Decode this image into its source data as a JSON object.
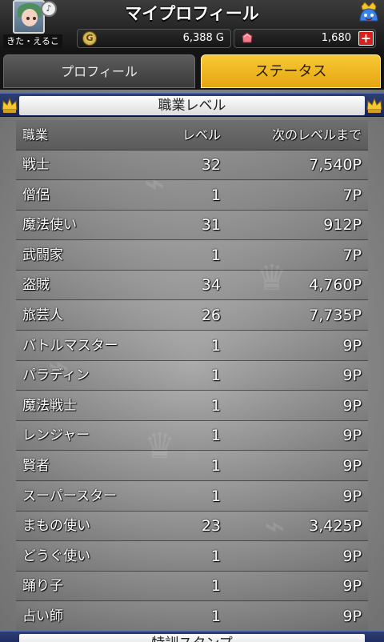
{
  "header": {
    "title": "マイプロフィール",
    "player_name": "きた・えるこ",
    "gold": "6,388 G",
    "gems": "1,680",
    "coin_symbol": "G",
    "plus_symbol": "+",
    "badge_symbol": "♪"
  },
  "tabs": [
    {
      "label": "プロフィール",
      "selected": false
    },
    {
      "label": "ステータス",
      "selected": true
    }
  ],
  "section": {
    "title": "職業レベル",
    "next_section_title": "特訓スタンプ"
  },
  "table": {
    "headers": {
      "job": "職業",
      "level": "レベル",
      "next": "次のレベルまで"
    },
    "rows": [
      {
        "job": "戦士",
        "level": "32",
        "next": "7,540P"
      },
      {
        "job": "僧侶",
        "level": "1",
        "next": "7P"
      },
      {
        "job": "魔法使い",
        "level": "31",
        "next": "912P"
      },
      {
        "job": "武闘家",
        "level": "1",
        "next": "7P"
      },
      {
        "job": "盗賊",
        "level": "34",
        "next": "4,760P"
      },
      {
        "job": "旅芸人",
        "level": "26",
        "next": "7,735P"
      },
      {
        "job": "バトルマスター",
        "level": "1",
        "next": "9P"
      },
      {
        "job": "パラディン",
        "level": "1",
        "next": "9P"
      },
      {
        "job": "魔法戦士",
        "level": "1",
        "next": "9P"
      },
      {
        "job": "レンジャー",
        "level": "1",
        "next": "9P"
      },
      {
        "job": "賢者",
        "level": "1",
        "next": "9P"
      },
      {
        "job": "スーパースター",
        "level": "1",
        "next": "9P"
      },
      {
        "job": "まもの使い",
        "level": "23",
        "next": "3,425P"
      },
      {
        "job": "どうぐ使い",
        "level": "1",
        "next": "9P"
      },
      {
        "job": "踊り子",
        "level": "1",
        "next": "9P"
      },
      {
        "job": "占い師",
        "level": "1",
        "next": "9P"
      }
    ]
  },
  "colors": {
    "active_tab": "#f2bb23",
    "section_bar": "#1f2d66",
    "gem_plus": "#d8201a"
  }
}
